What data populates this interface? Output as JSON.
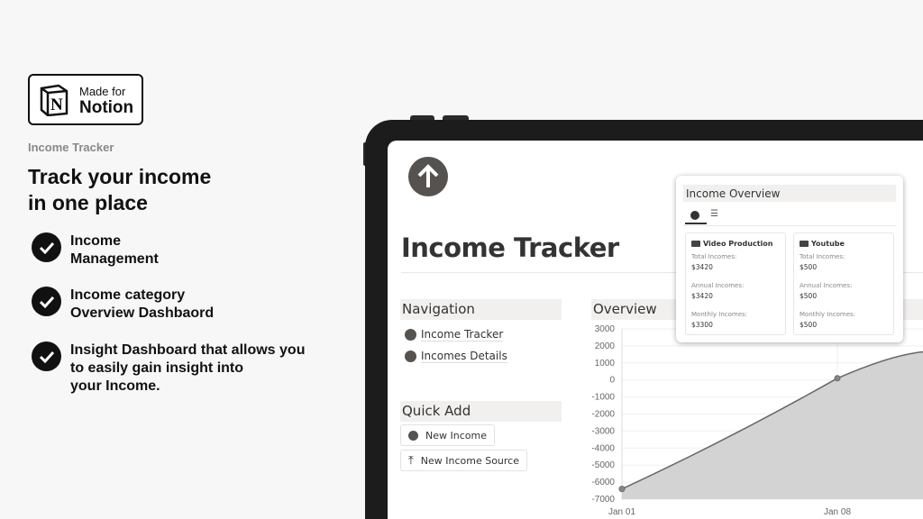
{
  "badge": {
    "line1": "Made for",
    "line2": "Notion",
    "logo": "notion-logo"
  },
  "kicker": "Income Tracker",
  "headline": {
    "line1": "Track your income",
    "line2": "in one place"
  },
  "features": [
    {
      "lines": [
        "Income",
        "Management"
      ]
    },
    {
      "lines": [
        "Income category",
        "Overview Dashbaord"
      ]
    },
    {
      "lines": [
        "Insight Dashboard that allows you",
        "to easily gain insight into",
        "your Income."
      ]
    }
  ],
  "app": {
    "page_icon": "arrow-up-circle-icon",
    "title": "Income Tracker",
    "navigation": {
      "heading": "Navigation",
      "links": [
        "Income Tracker",
        "Incomes Details"
      ]
    },
    "quick_add": {
      "heading": "Quick Add",
      "buttons": [
        {
          "label": "New Income",
          "icon": "arrow-up-circle-icon"
        },
        {
          "label": "New Income Source",
          "icon": "arrow-up-to-line-icon"
        }
      ]
    },
    "overview": {
      "heading": "Overview"
    }
  },
  "popup": {
    "title": "Income Overview",
    "tabs": [
      "gallery-view",
      "list-view"
    ],
    "cards": [
      {
        "name": "Video Production",
        "icon": "video-camera-icon",
        "total_label": "Total Incomes:",
        "total": "$3420",
        "annual_label": "Annual Incomes:",
        "annual": "$3420",
        "monthly_label": "Monthly Incomes:",
        "monthly": "$3300"
      },
      {
        "name": "Youtube",
        "icon": "youtube-icon",
        "total_label": "Total Incomes:",
        "total": "$500",
        "annual_label": "Annual Incomes:",
        "annual": "$500",
        "monthly_label": "Monthly Incomes:",
        "monthly": "$500"
      }
    ]
  },
  "chart_data": {
    "type": "area",
    "x": [
      "Jan 01",
      "Jan 08"
    ],
    "values": [
      -6400,
      100
    ],
    "yticks": [
      "3000",
      "2000",
      "1000",
      "0",
      "-1000",
      "-2000",
      "-3000",
      "-4000",
      "-5000",
      "-6000",
      "-7000"
    ],
    "ylim": [
      -7000,
      3000
    ],
    "grid": true,
    "fill_color": "#d3d3d3",
    "line_color": "#666666"
  }
}
